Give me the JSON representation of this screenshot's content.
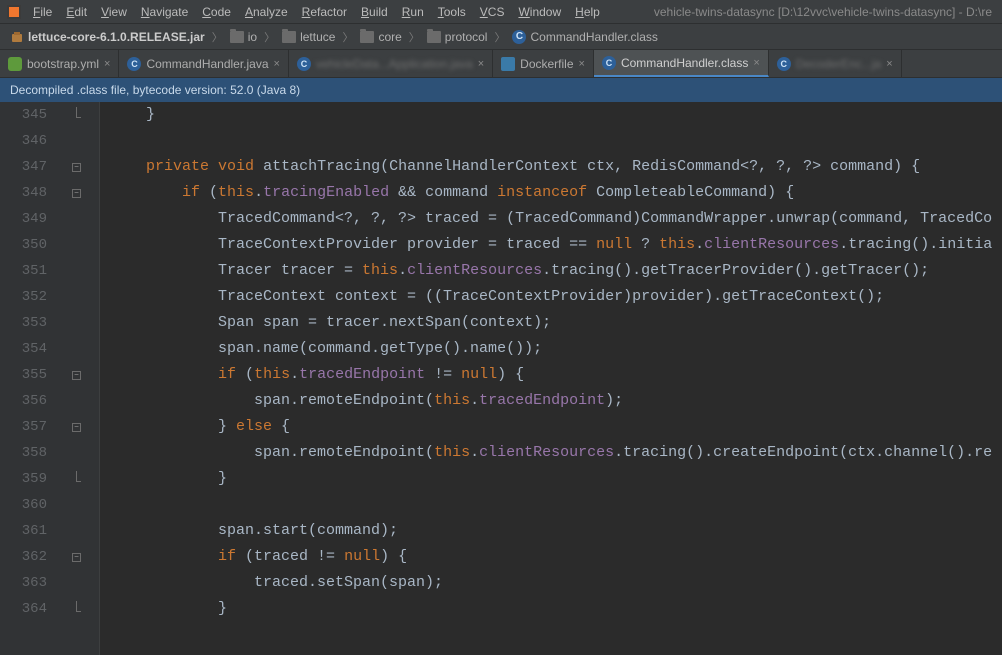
{
  "menu": {
    "items": [
      "File",
      "Edit",
      "View",
      "Navigate",
      "Code",
      "Analyze",
      "Refactor",
      "Build",
      "Run",
      "Tools",
      "VCS",
      "Window",
      "Help"
    ]
  },
  "titlebar_path": "vehicle-twins-datasync [D:\\12vvc\\vehicle-twins-datasync] - D:\\re",
  "breadcrumb": {
    "jar": "lettuce-core-6.1.0.RELEASE.jar",
    "io": "io",
    "lettuce": "lettuce",
    "core": "core",
    "protocol": "protocol",
    "cls": "CommandHandler.class"
  },
  "tabs": [
    {
      "label": "bootstrap.yml",
      "icon": "yml",
      "active": false
    },
    {
      "label": "CommandHandler.java",
      "icon": "cls",
      "active": false
    },
    {
      "label": "vehicleData...Application.java",
      "icon": "cls",
      "active": false,
      "obscured": true
    },
    {
      "label": "Dockerfile",
      "icon": "docker",
      "active": false
    },
    {
      "label": "CommandHandler.class",
      "icon": "cls",
      "active": true
    },
    {
      "label": "DecoderEnc...ja",
      "icon": "cls",
      "active": false,
      "obscured": true
    }
  ],
  "banner": "Decompiled .class file, bytecode version: 52.0 (Java 8)",
  "code": {
    "first_line": 345,
    "lines": [
      {
        "n": 345,
        "fold": "end",
        "html": "    }"
      },
      {
        "n": 346,
        "html": ""
      },
      {
        "n": 347,
        "fold": "open",
        "html": "    <span class=\"kw\">private</span> <span class=\"kw\">void</span> attachTracing(ChannelHandlerContext ctx, RedisCommand&lt;?, ?, ?&gt; command) {"
      },
      {
        "n": 348,
        "fold": "open",
        "html": "        <span class=\"kw\">if</span> (<span class=\"kw\">this</span>.<span class=\"field\">tracingEnabled</span> &amp;&amp; command <span class=\"kw\">instanceof</span> CompleteableCommand) {"
      },
      {
        "n": 349,
        "html": "            TracedCommand&lt;?, ?, ?&gt; traced = (TracedCommand)CommandWrapper.unwrap(command, TracedCo"
      },
      {
        "n": 350,
        "html": "            TraceContextProvider provider = traced == <span class=\"lit\">null</span> ? <span class=\"kw\">this</span>.<span class=\"field\">clientResources</span>.tracing().initia"
      },
      {
        "n": 351,
        "html": "            Tracer tracer = <span class=\"kw\">this</span>.<span class=\"field\">clientResources</span>.tracing().getTracerProvider().getTracer();"
      },
      {
        "n": 352,
        "html": "            TraceContext context = ((TraceContextProvider)provider).getTraceContext();"
      },
      {
        "n": 353,
        "html": "            Span span = tracer.nextSpan(context);"
      },
      {
        "n": 354,
        "html": "            span.name(command.getType().name());"
      },
      {
        "n": 355,
        "fold": "open",
        "html": "            <span class=\"kw\">if</span> (<span class=\"kw\">this</span>.<span class=\"field\">tracedEndpoint</span> != <span class=\"lit\">null</span>) {"
      },
      {
        "n": 356,
        "html": "                span.remoteEndpoint(<span class=\"kw\">this</span>.<span class=\"field\">tracedEndpoint</span>);"
      },
      {
        "n": 357,
        "fold": "open",
        "html": "            } <span class=\"kw\">else</span> {"
      },
      {
        "n": 358,
        "html": "                span.remoteEndpoint(<span class=\"kw\">this</span>.<span class=\"field\">clientResources</span>.tracing().createEndpoint(ctx.channel().re"
      },
      {
        "n": 359,
        "fold": "end",
        "html": "            }"
      },
      {
        "n": 360,
        "html": ""
      },
      {
        "n": 361,
        "html": "            span.start(command);"
      },
      {
        "n": 362,
        "fold": "open",
        "html": "            <span class=\"kw\">if</span> (traced != <span class=\"lit\">null</span>) {"
      },
      {
        "n": 363,
        "html": "                traced.setSpan(span);"
      },
      {
        "n": 364,
        "fold": "end",
        "html": "            }"
      }
    ]
  }
}
